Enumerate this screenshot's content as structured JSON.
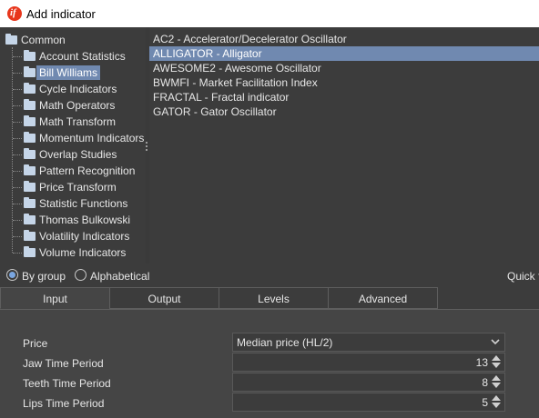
{
  "window": {
    "title": "Add indicator",
    "icon": "app-logo-icon",
    "icon_glyph": "if",
    "icon_color": "#e8361c"
  },
  "tree": {
    "root": "Common",
    "items": [
      {
        "label": "Account Statistics"
      },
      {
        "label": "Bill Williams",
        "selected": true
      },
      {
        "label": "Cycle Indicators"
      },
      {
        "label": "Math Operators"
      },
      {
        "label": "Math Transform"
      },
      {
        "label": "Momentum Indicators"
      },
      {
        "label": "Overlap Studies"
      },
      {
        "label": "Pattern Recognition"
      },
      {
        "label": "Price Transform"
      },
      {
        "label": "Statistic Functions"
      },
      {
        "label": "Thomas Bulkowski"
      },
      {
        "label": "Volatility Indicators"
      },
      {
        "label": "Volume Indicators"
      }
    ]
  },
  "indicators": [
    {
      "label": "AC2 - Accelerator/Decelerator Oscillator"
    },
    {
      "label": "ALLIGATOR - Alligator",
      "selected": true
    },
    {
      "label": "AWESOME2 - Awesome Oscillator"
    },
    {
      "label": "BWMFI - Market Facilitation Index"
    },
    {
      "label": "FRACTAL - Fractal indicator"
    },
    {
      "label": "GATOR - Gator Oscillator"
    }
  ],
  "grouping": {
    "by_group": "By group",
    "alphabetical": "Alphabetical",
    "selected": "by_group",
    "quick_filter_label": "Quick fi"
  },
  "tabs": [
    {
      "label": "Input",
      "active": true
    },
    {
      "label": "Output"
    },
    {
      "label": "Levels"
    },
    {
      "label": "Advanced"
    }
  ],
  "inputs": {
    "price": {
      "label": "Price",
      "value": "Median price (HL/2)"
    },
    "jaw": {
      "label": "Jaw Time Period",
      "value": "13"
    },
    "teeth": {
      "label": "Teeth Time Period",
      "value": "8"
    },
    "lips": {
      "label": "Lips Time Period",
      "value": "5"
    }
  },
  "colors": {
    "selection": "#7089b0",
    "background": "#3c3c3c",
    "panel": "#454545"
  }
}
